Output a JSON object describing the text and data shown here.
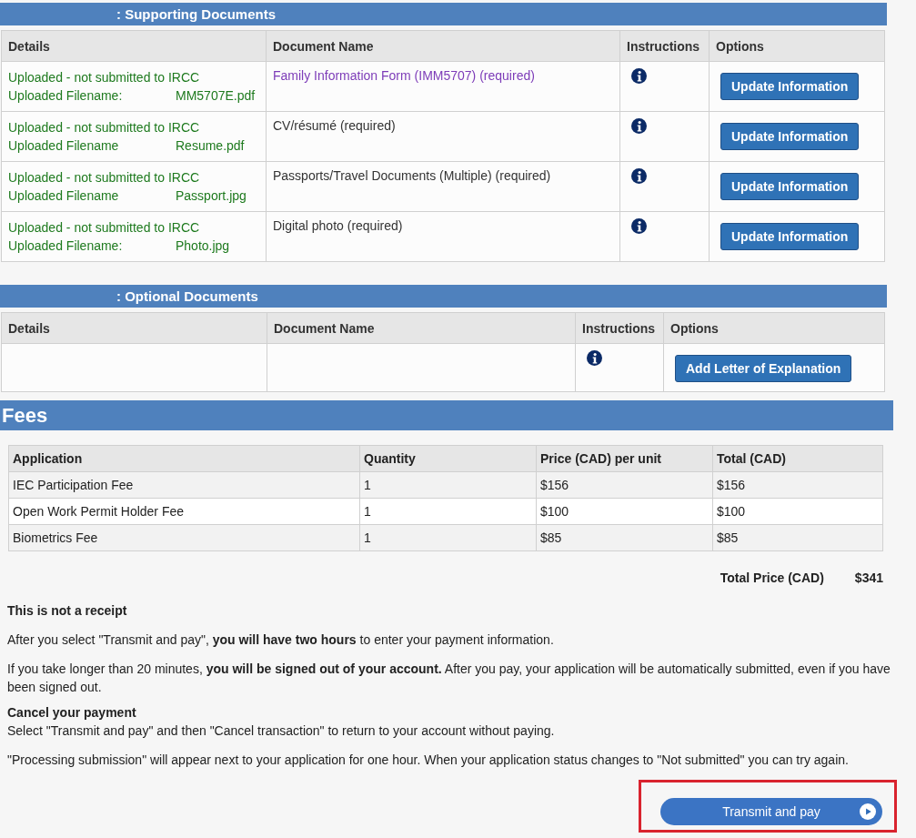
{
  "supporting_documents": {
    "title": ": Supporting Documents",
    "columns": [
      "Details",
      "Document Name",
      "Instructions",
      "Options"
    ],
    "rows": [
      {
        "status": "Uploaded - not submitted to IRCC",
        "filename_label": "Uploaded Filename:",
        "filename": "MM5707E.pdf",
        "document_name": "Family Information Form (IMM5707)",
        "kind": "link",
        "requirement": "(required)",
        "button": "Update Information"
      },
      {
        "status": "Uploaded - not submitted to IRCC",
        "filename_label": "Uploaded Filename",
        "filename": "Resume.pdf",
        "document_name": "CV/résumé",
        "kind": "plain",
        "requirement": "(required)",
        "button": "Update Information"
      },
      {
        "status": "Uploaded - not submitted to IRCC",
        "filename_label": "Uploaded Filename",
        "filename": "Passport.jpg",
        "document_name": "Passports/Travel Documents (Multiple)",
        "kind": "plain",
        "requirement": "(required)",
        "button": "Update Information"
      },
      {
        "status": "Uploaded - not submitted to IRCC",
        "filename_label": "Uploaded Filename:",
        "filename": "Photo.jpg",
        "document_name": "Digital photo",
        "kind": "plain",
        "requirement": "(required)",
        "button": "Update Information"
      }
    ]
  },
  "optional_documents": {
    "title": ": Optional Documents",
    "columns": [
      "Details",
      "Document Name",
      "Instructions",
      "Options"
    ],
    "button": "Add Letter of Explanation"
  },
  "fees": {
    "title": "Fees",
    "columns": [
      "Application",
      "Quantity",
      "Price (CAD) per unit",
      "Total (CAD)"
    ],
    "rows": [
      [
        "IEC Participation Fee",
        "1",
        "$156",
        "$156"
      ],
      [
        "Open Work Permit Holder Fee",
        "1",
        "$100",
        "$100"
      ],
      [
        "Biometrics Fee",
        "1",
        "$85",
        "$85"
      ]
    ],
    "total_label": "Total Price (CAD)",
    "total_value": "$341"
  },
  "notice": {
    "heading": "This is not a receipt",
    "paragraphs": [
      "After you select \"Transmit and pay\", **you will have two hours** to enter your payment information.",
      "If you take longer than 20 minutes, **you will be signed out of your account.** After you pay, your application will be automatically submitted, even if you have been signed out."
    ]
  },
  "cancel": {
    "heading": "Cancel your payment",
    "paragraphs": [
      "Select \"Transmit and pay\" and then \"Cancel transaction\" to return to your account without paying.",
      "\"Processing submission\" will appear next to your application for one hour. When your application status changes to \"Not submitted\" you can try again."
    ]
  },
  "transmit_button": {
    "label": "Transmit and pay",
    "highlighted": true
  }
}
